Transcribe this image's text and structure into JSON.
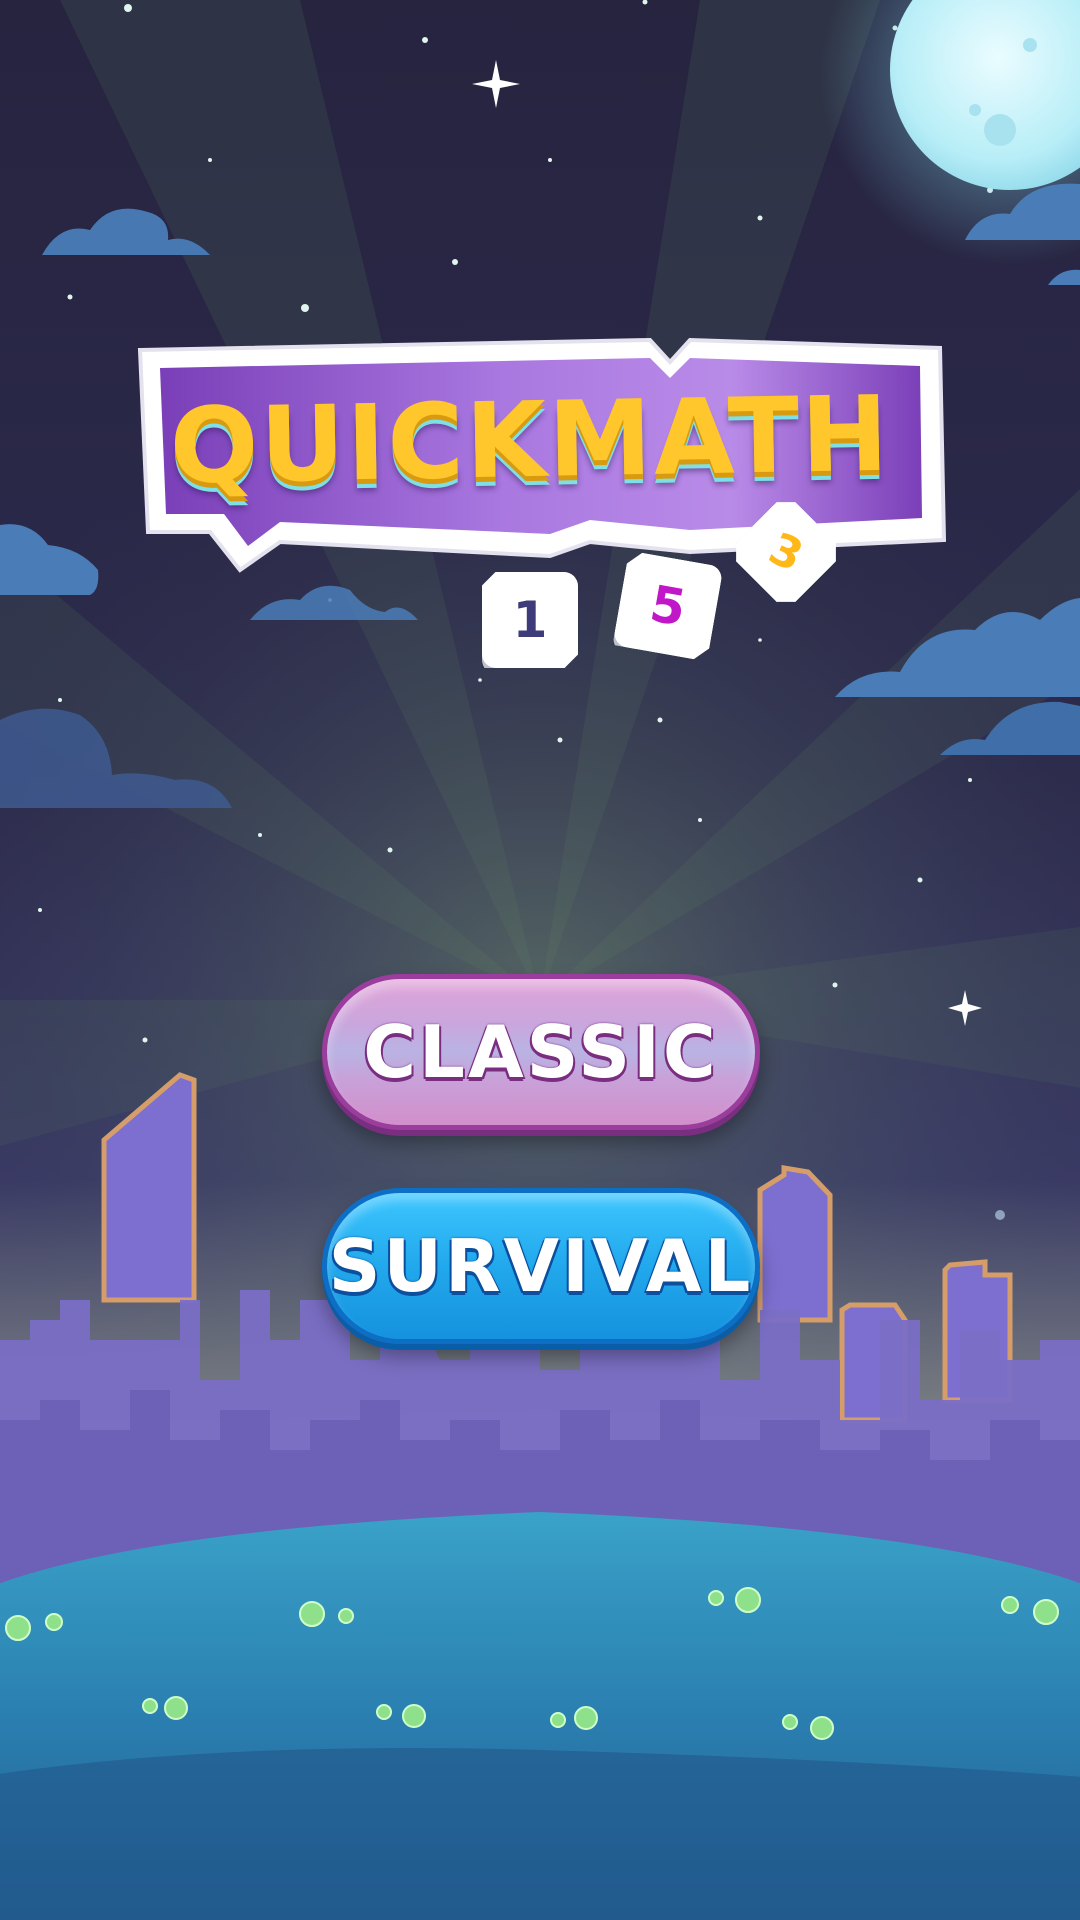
{
  "app": {
    "title": "QUICKMATH"
  },
  "title_tiles": [
    {
      "value": "1",
      "color": "#3d3b7a"
    },
    {
      "value": "5",
      "color": "#c018c8"
    },
    {
      "value": "3",
      "color": "#ffb818"
    }
  ],
  "menu": {
    "classic_label": "CLASSIC",
    "survival_label": "SURVIVAL"
  },
  "colors": {
    "title_text": "#ffc72b",
    "banner_purple": "#8a4fc8",
    "classic_button": "#c9a6dc",
    "survival_button": "#22a8ec",
    "ground": "#2a88b8"
  },
  "scene": {
    "background": "night sky with stars and moon",
    "skyline": "purple city silhouette",
    "ground": "blue hill with green flowers"
  }
}
